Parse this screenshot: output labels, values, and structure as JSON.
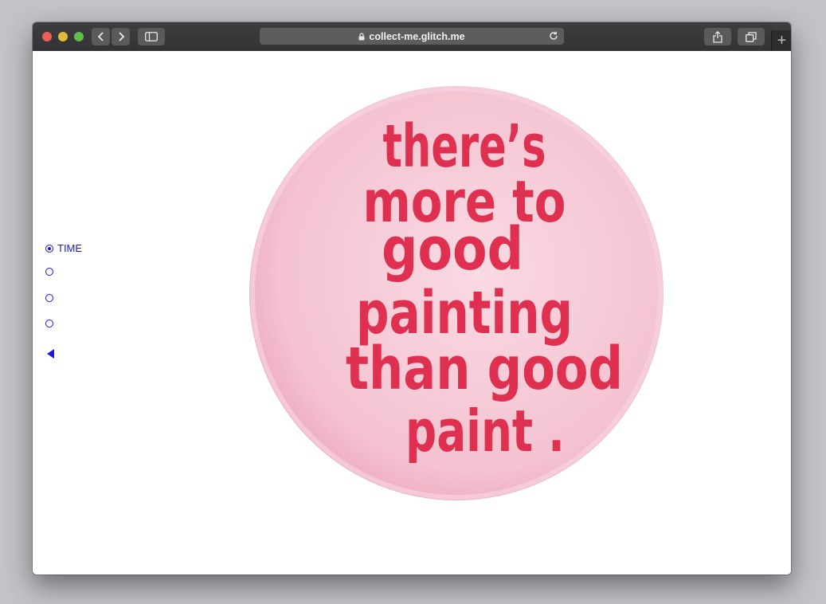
{
  "browser": {
    "url": "collect-me.glitch.me",
    "new_tab_glyph": "+"
  },
  "nav": {
    "items": [
      {
        "label": "TIME",
        "checked": true
      },
      {
        "label": "",
        "checked": false
      },
      {
        "label": "",
        "checked": false
      },
      {
        "label": "",
        "checked": false
      }
    ],
    "prev_icon": "triangle-left-icon",
    "accent": "#1a1ad6"
  },
  "artwork": {
    "lines": [
      "there’s",
      "more to",
      "good",
      "painting",
      "than good",
      "paint ."
    ],
    "text_color": "#e0304f",
    "badge_color": "#f6c9d6"
  }
}
